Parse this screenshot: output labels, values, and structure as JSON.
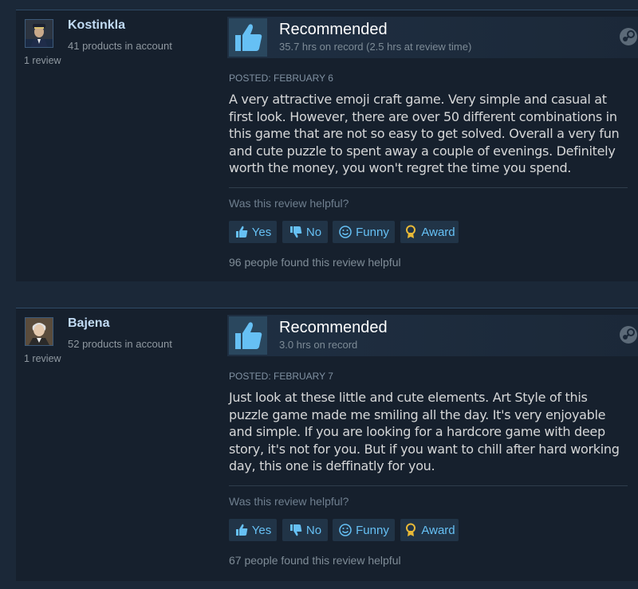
{
  "reviews": [
    {
      "username": "Kostinkla",
      "products": "41 products in account",
      "review_count": "1 review",
      "verdict": "Recommended",
      "hours": "35.7 hrs on record (2.5 hrs at review time)",
      "posted": "POSTED: FEBRUARY 6",
      "content": "A very attractive emoji craft game. Very simple and casual at first look. However, there are over 50 different combinations in this game that are not so easy to get solved. Overall a very fun and cute puzzle to spent away a couple of evenings. Definitely worth the money, you won't regret the time you spend.",
      "helpful_question": "Was this review helpful?",
      "buttons": {
        "yes": "Yes",
        "no": "No",
        "funny": "Funny",
        "award": "Award"
      },
      "found_helpful": "96 people found this review helpful"
    },
    {
      "username": "Bajena",
      "products": "52 products in account",
      "review_count": "1 review",
      "verdict": "Recommended",
      "hours": "3.0 hrs on record",
      "posted": "POSTED: FEBRUARY 7",
      "content": "Just look at these little and cute elements. Art Style of this puzzle game made me smiling all the day. It's very enjoyable and simple. If you are looking for a hardcore game with deep story, it's not for you. But if you want to chill after hard working day, this one is deffinatly for you.",
      "helpful_question": "Was this review helpful?",
      "buttons": {
        "yes": "Yes",
        "no": "No",
        "funny": "Funny",
        "award": "Award"
      },
      "found_helpful": "67 people found this review helpful"
    }
  ],
  "icons": {
    "thumbs_up": "thumbs-up-icon",
    "thumbs_down": "thumbs-down-icon",
    "funny": "smiley-icon",
    "award": "award-icon",
    "steam": "steam-icon"
  },
  "colors": {
    "background": "#1b2838",
    "card": "#16202d",
    "accent_link": "#66c0f4",
    "username": "#c1dbf4",
    "award_gold": "#e8b937"
  }
}
